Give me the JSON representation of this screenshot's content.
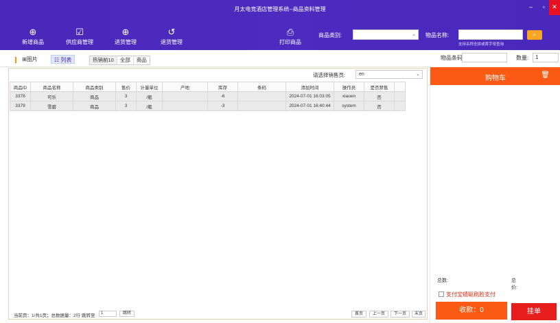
{
  "window": {
    "title": "月太电竞酒店管理系统--商品资料管理",
    "minimize": "–",
    "maximize": "▫",
    "close": "✕"
  },
  "toolbar": {
    "add_product": "新增商品",
    "supplier_mgmt": "供应商管理",
    "purchase_mgmt": "进货管理",
    "return_mgmt": "退货管理",
    "print_product": "打印商品"
  },
  "filters": {
    "category_label": "商品类别:",
    "category_value": "",
    "name_label": "物品名称:",
    "name_value": "",
    "name_hint": "支持名称全拼或首字母查询",
    "code_label": "物品条码:",
    "code_value": "",
    "qty_label": "数量:",
    "qty_value": "1"
  },
  "view": {
    "image_label": "图片",
    "list_label": "列表",
    "tabs": [
      "热销前10",
      "全部",
      "商品"
    ]
  },
  "seller": {
    "label": "请选择销售员:",
    "value": "en"
  },
  "table": {
    "headers": [
      "商品ID",
      "商品名称",
      "商品类别",
      "售价",
      "计量单位",
      "产地",
      "库存",
      "条码",
      "添加时间",
      "操作员",
      "是否禁售"
    ],
    "rows": [
      [
        "3378",
        "可乐",
        "商品",
        "3",
        "/瓶",
        "",
        "-6",
        "",
        "2024-07-01 16:03:05",
        "xiaoen",
        "否"
      ],
      [
        "3379",
        "雪碧",
        "商品",
        "3",
        "/瓶",
        "",
        "-3",
        "",
        "2024-07-01 16:40:44",
        "system",
        "否"
      ]
    ]
  },
  "pager": {
    "status": "当前页：1/共1页；总数据量：2行",
    "jump_label": "跳转至",
    "jump_value": "1",
    "jump_button": "跳转",
    "first": "首页",
    "prev": "上一页",
    "next": "下一页",
    "last": "末页"
  },
  "cart": {
    "title": "购物车",
    "total_count_label": "总数:",
    "total_price_label": "总价:",
    "pay_option": "支付宝蜻蜓刷脸支付",
    "collect_button": "收款：0",
    "hang_button": "挂单"
  },
  "colors": {
    "header_bg": "#4b28bb",
    "accent_orange": "#fb5a14",
    "hang_red": "#e81d1d",
    "search_btn": "#f6a623"
  }
}
